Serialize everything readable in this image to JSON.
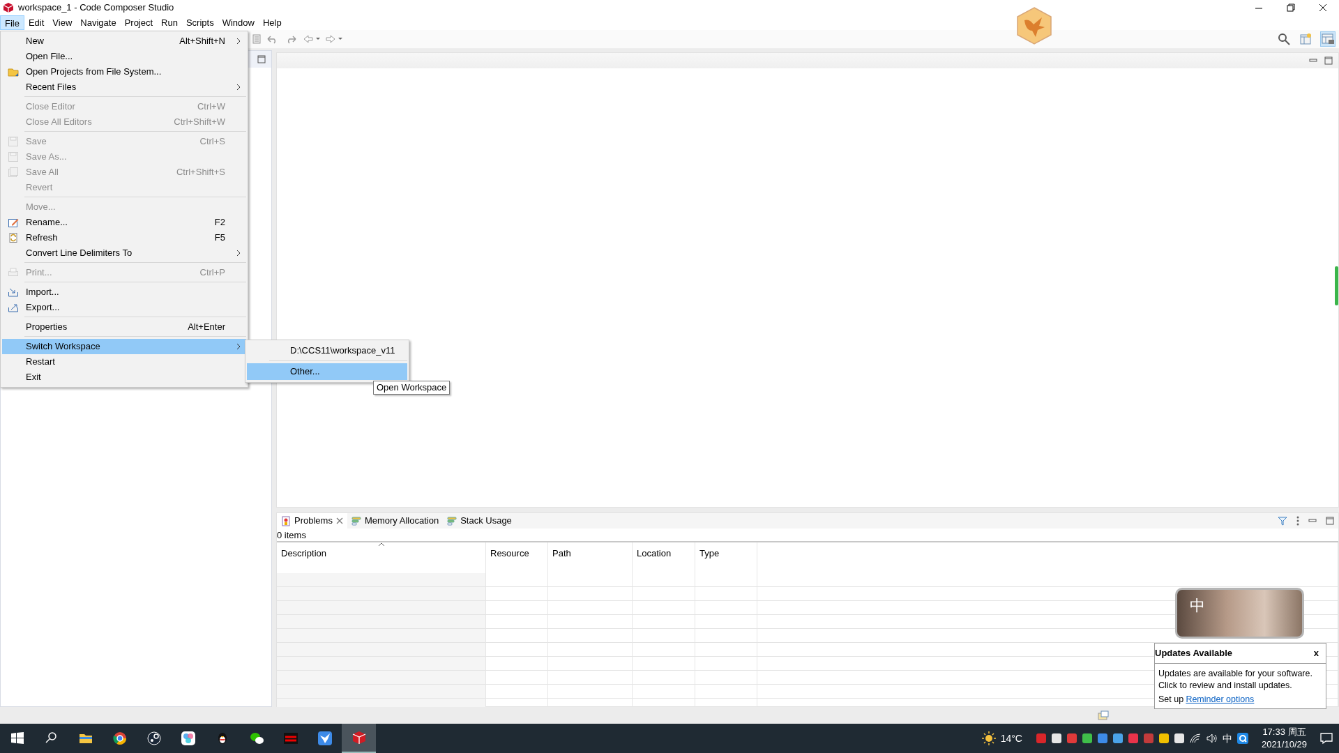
{
  "window": {
    "title": "workspace_1 - Code Composer Studio"
  },
  "menu_bar": [
    {
      "label": "File",
      "selected": true
    },
    {
      "label": "Edit",
      "selected": false
    },
    {
      "label": "View",
      "selected": false
    },
    {
      "label": "Navigate",
      "selected": false
    },
    {
      "label": "Project",
      "selected": false
    },
    {
      "label": "Run",
      "selected": false
    },
    {
      "label": "Scripts",
      "selected": false
    },
    {
      "label": "Window",
      "selected": false
    },
    {
      "label": "Help",
      "selected": false
    }
  ],
  "file_menu": [
    {
      "kind": "item",
      "label": "New",
      "shortcut": "Alt+Shift+N",
      "submenu": true,
      "disabled": false,
      "selected": false
    },
    {
      "kind": "item",
      "label": "Open File...",
      "disabled": false,
      "selected": false
    },
    {
      "kind": "item",
      "label": "Open Projects from File System...",
      "disabled": false,
      "selected": false
    },
    {
      "kind": "item",
      "label": "Recent Files",
      "submenu": true,
      "disabled": false,
      "selected": false
    },
    {
      "kind": "separator"
    },
    {
      "kind": "item",
      "label": "Close Editor",
      "shortcut": "Ctrl+W",
      "disabled": true,
      "selected": false
    },
    {
      "kind": "item",
      "label": "Close All Editors",
      "shortcut": "Ctrl+Shift+W",
      "disabled": true,
      "selected": false
    },
    {
      "kind": "separator"
    },
    {
      "kind": "item",
      "label": "Save",
      "shortcut": "Ctrl+S",
      "disabled": true,
      "selected": false
    },
    {
      "kind": "item",
      "label": "Save As...",
      "disabled": true,
      "selected": false
    },
    {
      "kind": "item",
      "label": "Save All",
      "shortcut": "Ctrl+Shift+S",
      "disabled": true,
      "selected": false
    },
    {
      "kind": "item",
      "label": "Revert",
      "disabled": true,
      "selected": false
    },
    {
      "kind": "separator"
    },
    {
      "kind": "item",
      "label": "Move...",
      "disabled": true,
      "selected": false
    },
    {
      "kind": "item",
      "label": "Rename...",
      "shortcut": "F2",
      "disabled": false,
      "selected": false
    },
    {
      "kind": "item",
      "label": "Refresh",
      "shortcut": "F5",
      "disabled": false,
      "selected": false
    },
    {
      "kind": "item",
      "label": "Convert Line Delimiters To",
      "submenu": true,
      "disabled": false,
      "selected": false
    },
    {
      "kind": "separator"
    },
    {
      "kind": "item",
      "label": "Print...",
      "shortcut": "Ctrl+P",
      "disabled": true,
      "selected": false
    },
    {
      "kind": "separator"
    },
    {
      "kind": "item",
      "label": "Import...",
      "disabled": false,
      "selected": false
    },
    {
      "kind": "item",
      "label": "Export...",
      "disabled": false,
      "selected": false
    },
    {
      "kind": "separator"
    },
    {
      "kind": "item",
      "label": "Properties",
      "shortcut": "Alt+Enter",
      "disabled": false,
      "selected": false
    },
    {
      "kind": "separator"
    },
    {
      "kind": "item",
      "label": "Switch Workspace",
      "submenu": true,
      "disabled": false,
      "selected": true
    },
    {
      "kind": "item",
      "label": "Restart",
      "disabled": false,
      "selected": false
    },
    {
      "kind": "item",
      "label": "Exit",
      "disabled": false,
      "selected": false
    }
  ],
  "workspace_submenu": [
    {
      "kind": "item",
      "label": "D:\\CCS11\\workspace_v11",
      "selected": false
    },
    {
      "kind": "separator"
    },
    {
      "kind": "item",
      "label": "Other...",
      "selected": true
    }
  ],
  "tooltip": "Open Workspace",
  "bottom_panel": {
    "tabs": [
      {
        "label": "Problems",
        "selected": true
      },
      {
        "label": "Memory Allocation",
        "selected": false
      },
      {
        "label": "Stack Usage",
        "selected": false
      }
    ],
    "summary": "0 items",
    "columns": [
      "Description",
      "Resource",
      "Path",
      "Location",
      "Type"
    ]
  },
  "ime_badge": "中",
  "update_popup": {
    "title": "Updates Available",
    "close": "x",
    "lines": [
      "Updates are available for your software.",
      "Click to review and install updates."
    ],
    "setup_text": "Set up",
    "link": "Reminder options"
  },
  "taskbar": {
    "apps": [
      {
        "kind": "start",
        "active": false
      },
      {
        "kind": "search",
        "active": false
      },
      {
        "kind": "folder",
        "active": false
      },
      {
        "kind": "browser",
        "active": false
      },
      {
        "kind": "steam",
        "active": false
      },
      {
        "kind": "flower",
        "active": false
      },
      {
        "kind": "penguin",
        "active": false
      },
      {
        "kind": "chat",
        "active": false
      },
      {
        "kind": "atk",
        "active": false
      },
      {
        "kind": "bird",
        "active": false
      },
      {
        "kind": "cube",
        "active": true
      }
    ],
    "weather": "14°C",
    "tray_icons": [
      {
        "color": "#d9262a"
      },
      {
        "color": "#e6e6e6"
      },
      {
        "color": "#e03a3a"
      },
      {
        "color": "#3fbf4a"
      },
      {
        "color": "#3d8be8"
      },
      {
        "color": "#4aa3e8"
      },
      {
        "color": "#e8334a"
      },
      {
        "color": "#c23b3b"
      },
      {
        "color": "#f0c000"
      },
      {
        "color": "#e6e6e6"
      }
    ],
    "ime": "中",
    "time": "17:33 周五",
    "date": "2021/10/29"
  }
}
